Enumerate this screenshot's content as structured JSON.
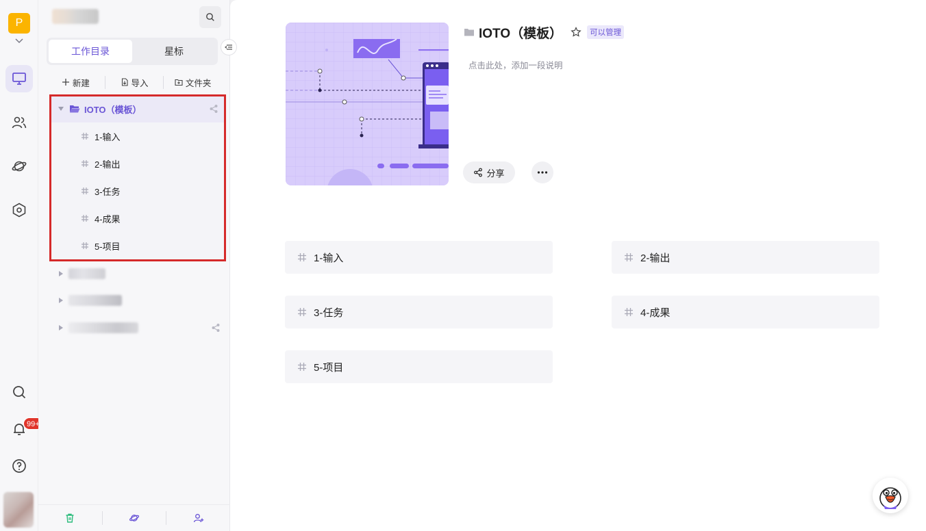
{
  "rail": {
    "workspace_letter": "P",
    "notification_count": "99+",
    "icons": [
      "desktop-icon",
      "users-icon",
      "planet-icon",
      "hexagon-settings-icon",
      "search-icon",
      "bell-icon",
      "help-icon"
    ]
  },
  "sidebar": {
    "tabs": [
      {
        "label": "工作目录",
        "active": true
      },
      {
        "label": "星标",
        "active": false
      }
    ],
    "actions": [
      {
        "label": "新建",
        "icon": "plus-icon"
      },
      {
        "label": "导入",
        "icon": "import-icon"
      },
      {
        "label": "文件夹",
        "icon": "folder-add-icon"
      }
    ],
    "folder": {
      "name": "IOTO（模板）",
      "expanded": true,
      "items": [
        "1-输入",
        "2-输出",
        "3-任务",
        "4-成果",
        "5-项目"
      ]
    }
  },
  "main": {
    "title": "IOTO（模板）",
    "permission": "可以管理",
    "description_placeholder": "点击此处，添加一段说明",
    "share_label": "分享",
    "cards": [
      "1-输入",
      "2-输出",
      "3-任务",
      "4-成果",
      "5-项目"
    ]
  },
  "colors": {
    "accent": "#6a55d6",
    "workspace_badge": "#fbb400",
    "highlight_border": "#d52a2a",
    "badge_red": "#e0352b"
  }
}
